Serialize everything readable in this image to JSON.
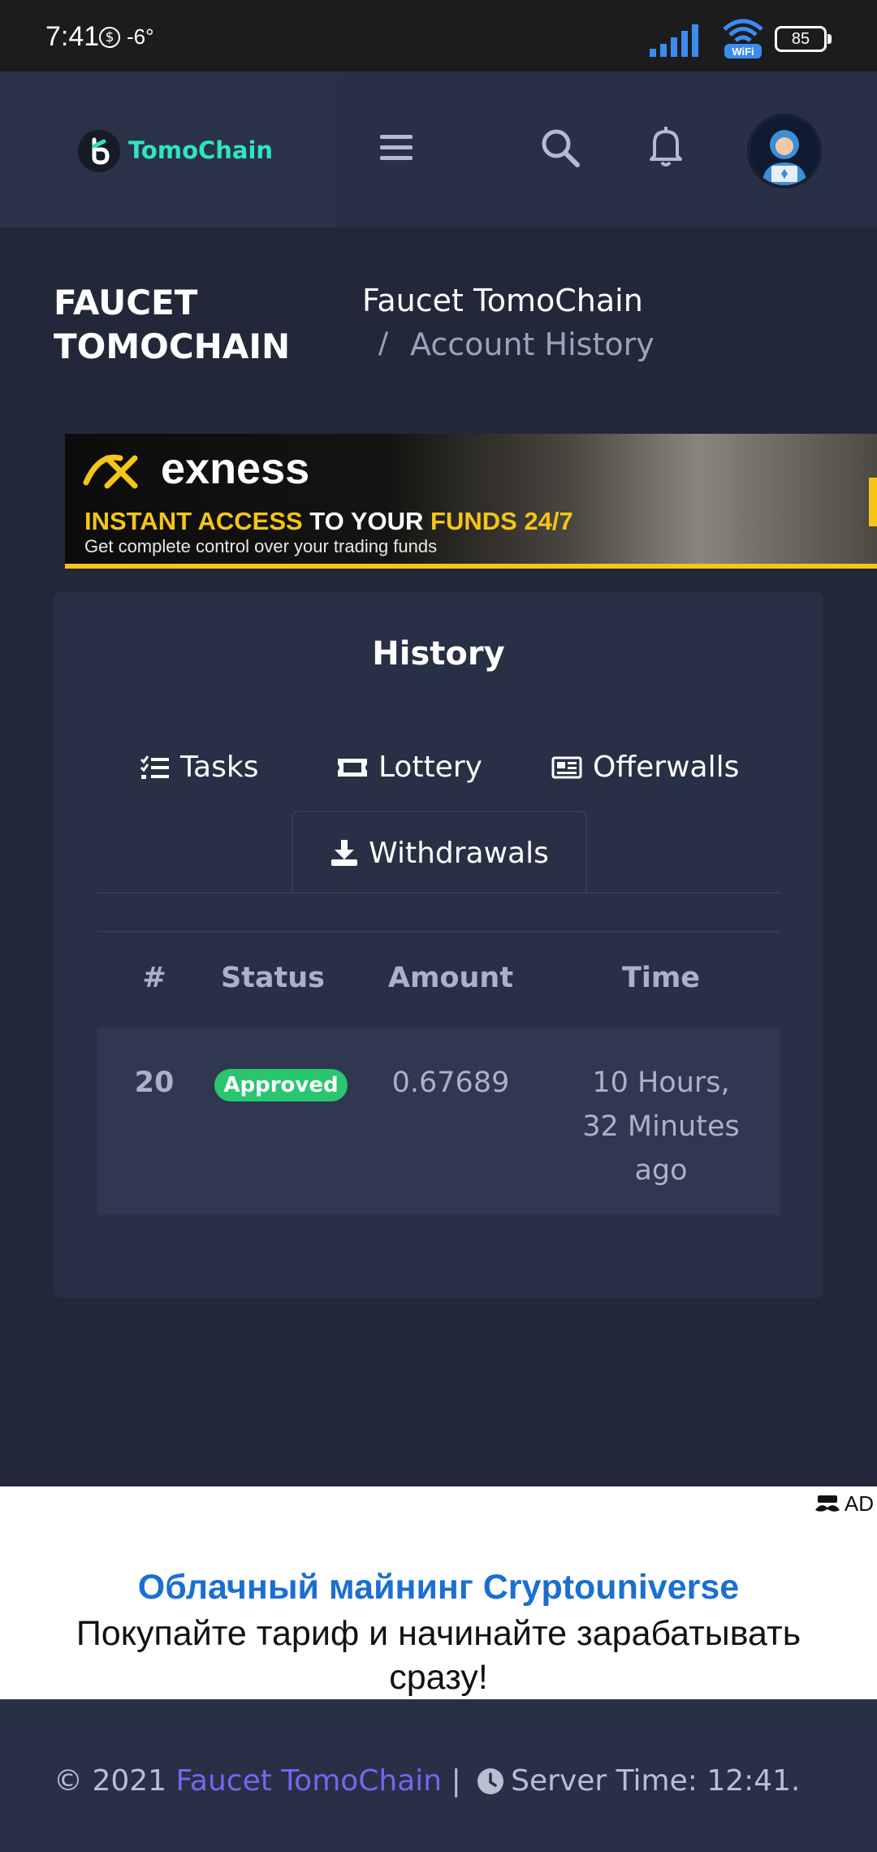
{
  "status_bar": {
    "time": "7:41",
    "coin_symbol": "$",
    "temperature": "-6°",
    "battery": "85",
    "wifi_label": "WiFi"
  },
  "header": {
    "brand": "TomoChain",
    "icons": [
      "menu-icon",
      "search-icon",
      "bell-icon",
      "avatar"
    ]
  },
  "page": {
    "title": "FAUCET TOMOCHAIN",
    "breadcrumb": [
      "Faucet TomoChain",
      "Account History"
    ],
    "breadcrumb_separator": "/"
  },
  "banner_ad": {
    "brand": "exness",
    "headline_1": "INSTANT ACCESS",
    "headline_2": " TO YOUR ",
    "headline_3": "FUNDS 24/7",
    "subline": "Get complete control over your trading funds"
  },
  "history": {
    "title": "History",
    "tabs": [
      {
        "label": "Tasks",
        "icon": "tasks-icon"
      },
      {
        "label": "Lottery",
        "icon": "ticket-icon"
      },
      {
        "label": "Offerwalls",
        "icon": "newspaper-icon"
      },
      {
        "label": "Withdrawals",
        "icon": "download-icon",
        "active": true
      }
    ],
    "columns": [
      "#",
      "Status",
      "Amount",
      "Time"
    ],
    "rows": [
      {
        "id": "20",
        "status": "Approved",
        "amount": "0.67689",
        "time": "10 Hours, 32 Minutes ago"
      }
    ]
  },
  "bottom_ad": {
    "tag": "AD",
    "title": "Облачный майнинг Cryptouniverse",
    "text": "Покупайте тариф и начинайте зарабатывать сразу!"
  },
  "footer": {
    "copyright": "© 2021 ",
    "link": "Faucet TomoChain",
    "separator": " | ",
    "server_time": "Server Time: 12:41."
  },
  "colors": {
    "accent": "#7367f0",
    "brand": "#2fe5c0",
    "success": "#28c76f",
    "background": "#222839",
    "card": "#283046"
  }
}
